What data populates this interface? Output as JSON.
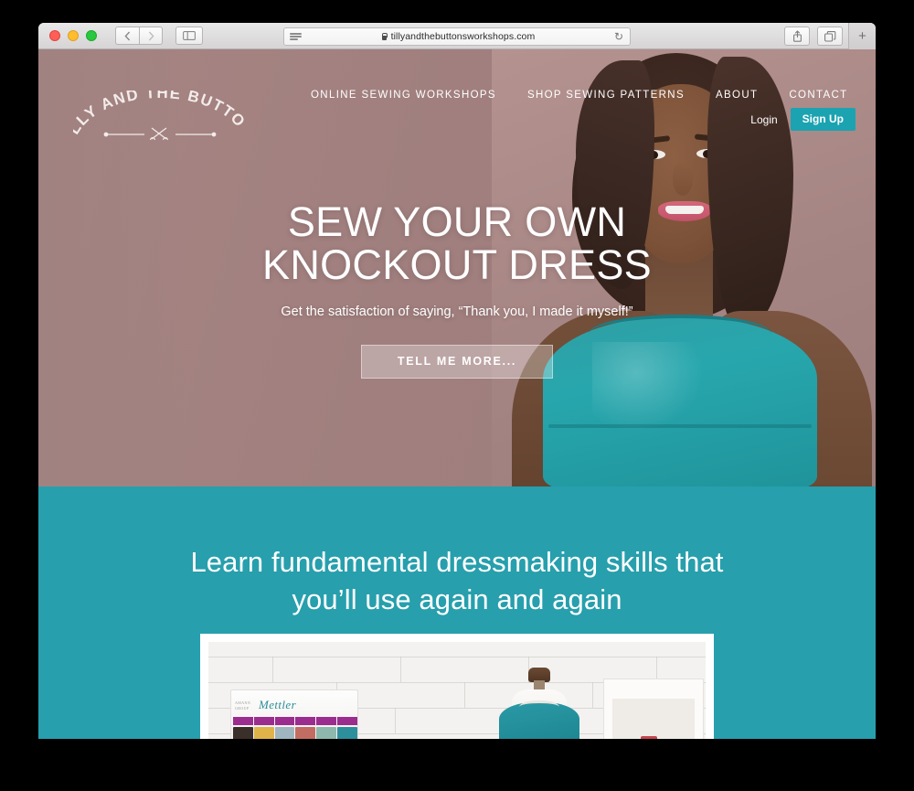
{
  "browser": {
    "traffic_lights": [
      "close",
      "minimize",
      "zoom"
    ],
    "back_label": "‹",
    "forward_label": "›",
    "sidebar_label": "sidebar",
    "reader_label": "reader",
    "url": "tillyandthebuttonsworkshops.com",
    "reload_label": "↻",
    "share_label": "share",
    "tabs_label": "tabs",
    "new_tab_label": "+"
  },
  "site": {
    "logo": {
      "arc_text": "TILLY AND THE BUTTONS",
      "ornament": "scissors"
    },
    "nav": [
      {
        "label": "ONLINE SEWING WORKSHOPS"
      },
      {
        "label": "SHOP SEWING PATTERNS"
      },
      {
        "label": "ABOUT"
      },
      {
        "label": "CONTACT"
      }
    ],
    "account": {
      "login_label": "Login",
      "signup_label": "Sign Up"
    }
  },
  "hero": {
    "title_line1": "SEW YOUR OWN",
    "title_line2": "KNOCKOUT DRESS",
    "subtitle": "Get the satisfaction of saying, “Thank you, I made it myself!”",
    "cta_label": "TELL ME MORE..."
  },
  "skills": {
    "heading_line1": "Learn fundamental dressmaking skills that",
    "heading_line2": "you’ll use again and again",
    "photo_alt": "sewing studio with thread display, dress form and shelving",
    "thread_brand": "Mettler",
    "thread_brand_sub": "AMANN GROUP"
  },
  "colors": {
    "hero_background": "#a0817f",
    "teal": "#279fad",
    "signup_button": "#1ba3b1",
    "dress_teal": "#27a7ad",
    "thread_header": "#9b2d8f",
    "page_white": "#ffffff"
  }
}
